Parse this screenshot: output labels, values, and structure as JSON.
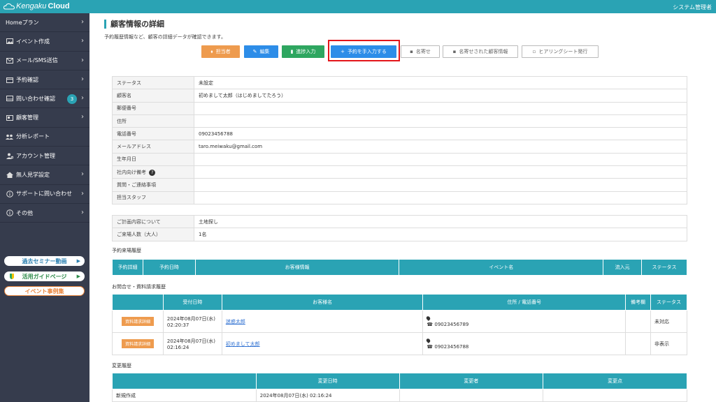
{
  "header": {
    "logo_kengaku": "Kengaku",
    "logo_cloud": "Cloud",
    "admin_label": "システム管理者"
  },
  "sidebar": {
    "items": [
      {
        "label": "Homeプラン",
        "icon": "none"
      },
      {
        "label": "イベント作成",
        "icon": "image-icon"
      },
      {
        "label": "メール/SMS送信",
        "icon": "mail-icon"
      },
      {
        "label": "予約確認",
        "icon": "calendar-icon"
      },
      {
        "label": "問い合わせ確認",
        "icon": "inbox-icon",
        "badge": "3"
      },
      {
        "label": "顧客管理",
        "icon": "card-icon"
      },
      {
        "label": "分析レポート",
        "icon": "users-icon"
      },
      {
        "label": "アカウント管理",
        "icon": "user-gear-icon"
      },
      {
        "label": "無人見学設定",
        "icon": "home-icon"
      },
      {
        "label": "サポートに問い合わせ",
        "icon": "info-icon"
      },
      {
        "label": "その他",
        "icon": "info-icon"
      }
    ],
    "pills": [
      {
        "label": "過去セミナー動画"
      },
      {
        "label": "活用ガイドページ"
      },
      {
        "label": "イベント事例集"
      }
    ]
  },
  "page": {
    "title": "顧客情報の詳細",
    "subtitle": "予約履歴情報など、顧客の詳細データが確認できます。"
  },
  "actions": {
    "staff": "担当者",
    "edit": "編集",
    "progress": "進捗入力",
    "manual_reserve": "予約を手入力する",
    "merge": "名寄せ",
    "merged_info": "名寄せされた顧客情報",
    "hearing_sheet": "ヒアリングシート発行"
  },
  "customer_info": [
    {
      "key": "ステータス",
      "value": "未設定"
    },
    {
      "key": "顧客名",
      "value": "初めまして太郎（はじめましてたろう）"
    },
    {
      "key": "郵便番号",
      "value": ""
    },
    {
      "key": "住所",
      "value": ""
    },
    {
      "key": "電話番号",
      "value": "09023456788"
    },
    {
      "key": "メールアドレス",
      "value": "taro.meiwaku@gmail.com"
    },
    {
      "key": "生年月日",
      "value": ""
    },
    {
      "key": "社内向け備考",
      "value": ""
    },
    {
      "key": "質問・ご連絡事項",
      "value": ""
    },
    {
      "key": "担当スタッフ",
      "value": ""
    }
  ],
  "plan_info": [
    {
      "key": "ご計画内容について",
      "value": "土地探し"
    },
    {
      "key": "ご来場人数（大人）",
      "value": "1名"
    }
  ],
  "reservation_history": {
    "title": "予約来場履歴",
    "columns": [
      "予約詳細",
      "予約日時",
      "お客様情報",
      "イベント名",
      "流入元",
      "ステータス"
    ]
  },
  "inquiry_history": {
    "title": "お問合せ・資料請求履歴",
    "columns": [
      "",
      "受付日時",
      "お客様名",
      "住所 / 電話番号",
      "備考欄",
      "ステータス"
    ],
    "rows": [
      {
        "tag": "資料請求詳細",
        "date": "2024年08月07日(水)",
        "time": "02:20:37",
        "name": "迷惑太郎",
        "phone": "09023456789",
        "status": "未対応"
      },
      {
        "tag": "資料請求詳細",
        "date": "2024年08月07日(水)",
        "time": "02:16:24",
        "name": "初めまして太郎",
        "phone": "09023456788",
        "status": "非表示"
      }
    ]
  },
  "change_history": {
    "title": "変更履歴",
    "columns": [
      "",
      "変更日時",
      "変更者",
      "変更点"
    ],
    "rows": [
      {
        "action": "新規作成",
        "datetime": "2024年08月07日(水) 02:16:24",
        "by": "",
        "change": ""
      }
    ]
  }
}
